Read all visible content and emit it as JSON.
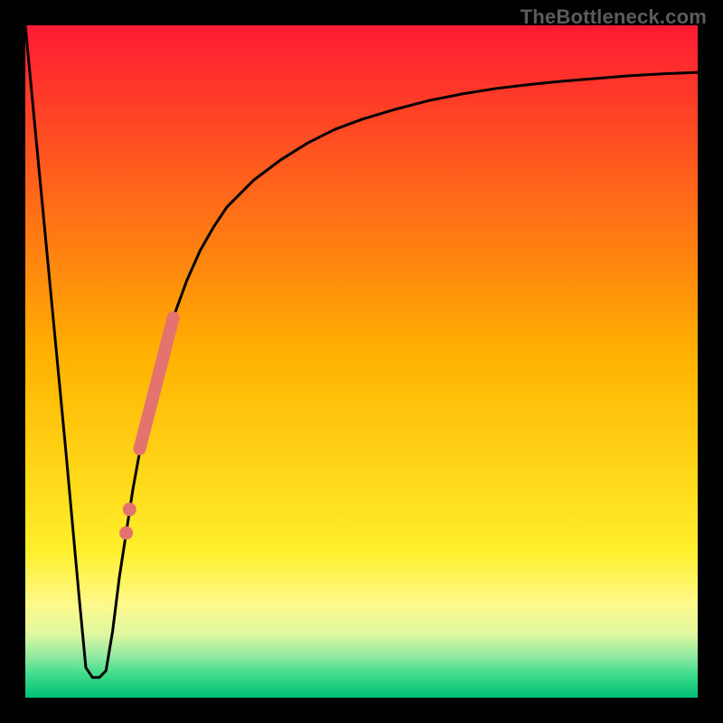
{
  "watermark": {
    "text": "TheBottleneck.com"
  },
  "chart_data": {
    "type": "line",
    "title": "",
    "xlabel": "",
    "ylabel": "",
    "xlim": [
      0,
      100
    ],
    "ylim": [
      0,
      100
    ],
    "grid": false,
    "gradient_stops": [
      {
        "offset": 0.0,
        "color": "#ff1a33"
      },
      {
        "offset": 0.5,
        "color": "#ffb400"
      },
      {
        "offset": 0.78,
        "color": "#ffef2a"
      },
      {
        "offset": 0.86,
        "color": "#fff98a"
      },
      {
        "offset": 0.905,
        "color": "#dff7a0"
      },
      {
        "offset": 0.94,
        "color": "#8de8a0"
      },
      {
        "offset": 0.965,
        "color": "#40dc8c"
      },
      {
        "offset": 1.0,
        "color": "#00c074"
      }
    ],
    "series": [
      {
        "name": "bottleneck-curve",
        "color": "#000000",
        "x": [
          0.0,
          2.0,
          4.0,
          6.0,
          8.0,
          9.0,
          10.0,
          11.0,
          12.0,
          13.0,
          14.0,
          16.0,
          18.0,
          20.0,
          22.0,
          24.0,
          26.0,
          28.0,
          30.0,
          34.0,
          38.0,
          42.0,
          46.0,
          50.0,
          55.0,
          60.0,
          65.0,
          70.0,
          75.0,
          80.0,
          85.0,
          90.0,
          95.0,
          100.0
        ],
        "y": [
          100.0,
          79.0,
          58.0,
          37.0,
          15.0,
          4.5,
          3.0,
          3.0,
          4.0,
          10.0,
          18.0,
          31.0,
          42.0,
          50.0,
          56.5,
          62.0,
          66.5,
          70.0,
          73.0,
          77.0,
          80.0,
          82.5,
          84.5,
          86.0,
          87.5,
          88.8,
          89.8,
          90.6,
          91.2,
          91.7,
          92.1,
          92.5,
          92.8,
          93.0
        ]
      }
    ],
    "marker_points": {
      "color": "#e4736f",
      "segment": {
        "x": [
          17.0,
          22.0
        ],
        "y": [
          37.0,
          56.5
        ]
      },
      "outliers": [
        {
          "x": 15.5,
          "y": 28.0
        },
        {
          "x": 15.0,
          "y": 24.5
        }
      ]
    }
  }
}
